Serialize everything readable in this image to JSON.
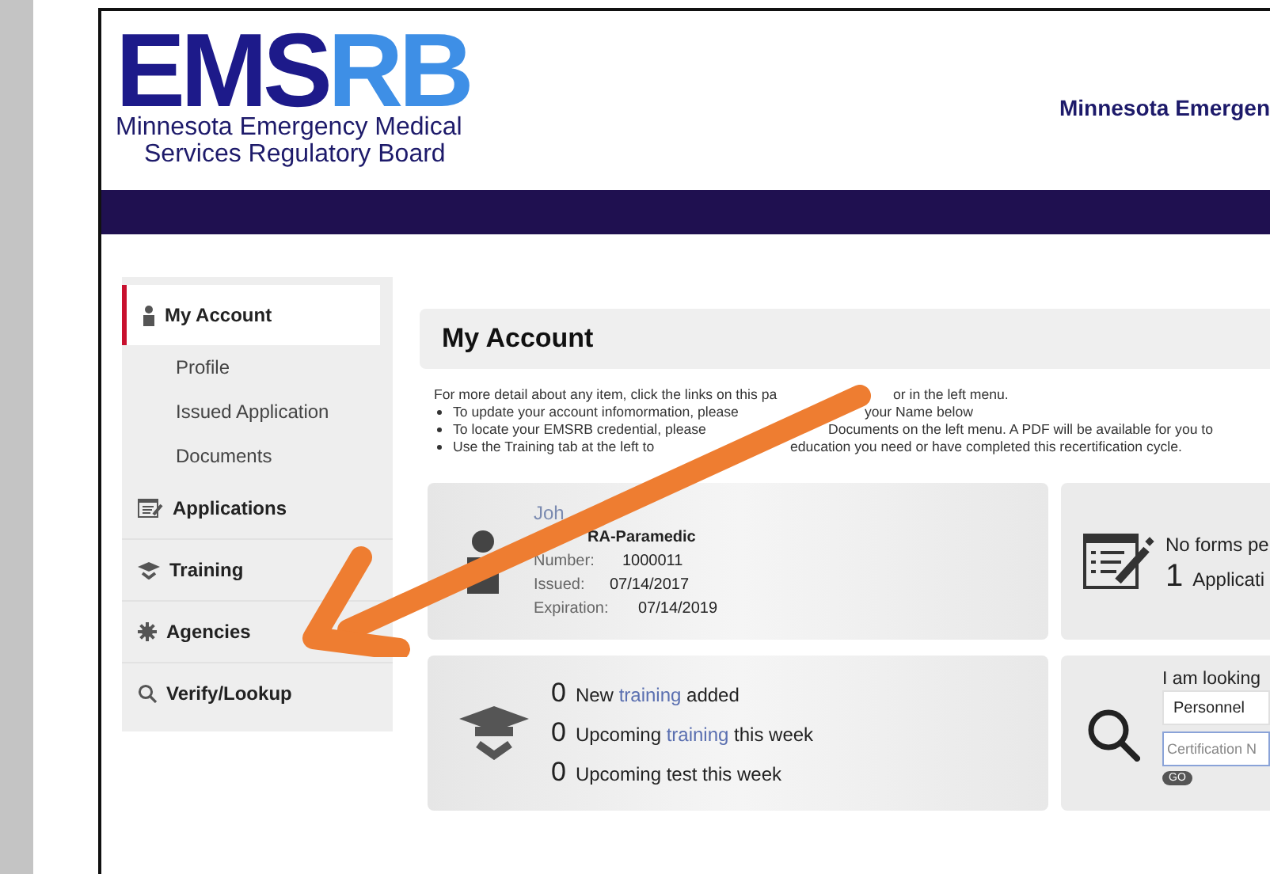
{
  "header": {
    "logo": {
      "mark_dark": "EMS",
      "mark_light": "RB",
      "lines": [
        "Minnesota Emergency Medical",
        "Services Regulatory Board"
      ]
    },
    "title": "Minnesota Emergen"
  },
  "sidebar": {
    "items": [
      {
        "kind": "section",
        "label": "My Account",
        "selected": true
      },
      {
        "kind": "subitem",
        "label": "Profile",
        "selected": false
      },
      {
        "kind": "subitem",
        "label": "Issued Application",
        "selected": false
      },
      {
        "kind": "subitem",
        "label": "Documents",
        "selected": false
      },
      {
        "kind": "section",
        "label": "Applications",
        "selected": false
      },
      {
        "kind": "section",
        "label": "Training",
        "selected": false
      },
      {
        "kind": "section",
        "label": "Agencies",
        "selected": false
      },
      {
        "kind": "section",
        "label": "Verify/Lookup",
        "selected": false
      }
    ]
  },
  "main": {
    "title": "My Account",
    "intro": [
      "For more detail about any item, click the links on this pa",
      "or in the left menu."
    ],
    "bullets": [
      [
        "To update your account infomormation, please",
        "your Name below"
      ],
      [
        "To locate your EMSRB credential, please",
        "Documents on the left menu.  A PDF will be available for you to"
      ],
      [
        "Use the Training tab at the left to",
        "education you need or have completed this recertification cycle."
      ]
    ],
    "credential_card": {
      "name": "Joh",
      "type": "RA-Paramedic",
      "fields": [
        {
          "label": "Number:",
          "value": "1000011"
        },
        {
          "label": "Issued:",
          "value": "07/14/2017"
        },
        {
          "label": "Expiration:",
          "value": "07/14/2019"
        }
      ]
    },
    "forms_card": {
      "message": "No forms pe",
      "count": "1",
      "count_label": "Applicati"
    },
    "training_card": {
      "rows": [
        {
          "count": "0",
          "parts": [
            {
              "text": "New",
              "link": false
            },
            {
              "text": "training",
              "link": true
            },
            {
              "text": "added",
              "link": false
            }
          ]
        },
        {
          "count": "0",
          "parts": [
            {
              "text": "Upcoming",
              "link": false
            },
            {
              "text": "training",
              "link": true
            },
            {
              "text": "this week",
              "link": false
            }
          ]
        },
        {
          "count": "0",
          "parts": [
            {
              "text": "Upcoming test this week",
              "link": false
            }
          ]
        }
      ]
    },
    "lookup_card": {
      "label": "I am looking",
      "select_value": "Personnel",
      "placeholder": "Certification N",
      "button": "GO"
    }
  }
}
